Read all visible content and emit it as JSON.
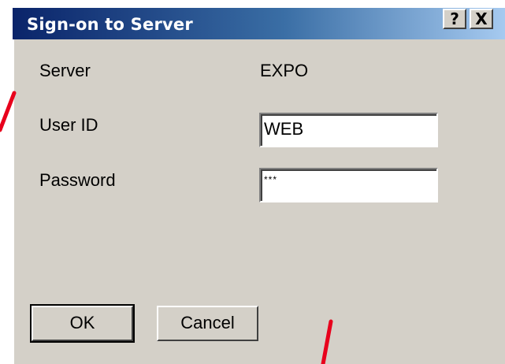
{
  "dialog": {
    "title": "Sign-on to Server",
    "help_glyph": "?",
    "close_glyph": "X"
  },
  "form": {
    "server_label": "Server",
    "server_value": "EXPO",
    "userid_label": "User ID",
    "userid_value": "WEB",
    "password_label": "Password",
    "password_value": "***"
  },
  "buttons": {
    "ok_label": "OK",
    "cancel_label": "Cancel"
  },
  "colors": {
    "titlebar_start": "#0a246a",
    "titlebar_end": "#a6caf0",
    "dialog_bg": "#d4d0c8",
    "annotation_red": "#e8001c"
  }
}
